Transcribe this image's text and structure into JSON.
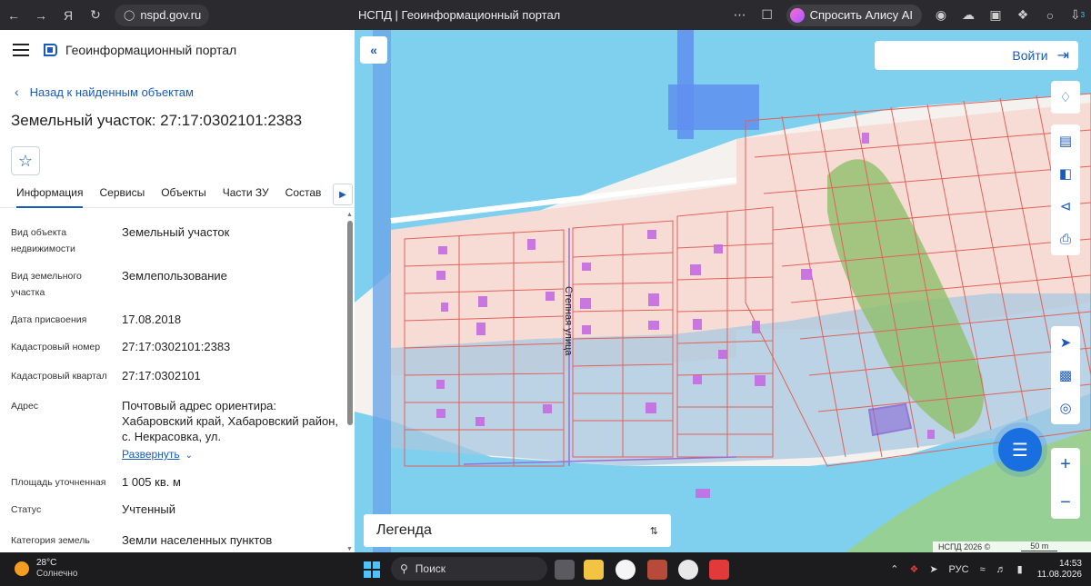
{
  "browser": {
    "url": "nspd.gov.ru",
    "tab_title": "НСПД | Геоинформационный портал",
    "alice_label": "Спросить Алису AI",
    "download_badge": "3"
  },
  "panel": {
    "portal_name": "Геоинформационный портал",
    "back_label": "Назад к найденным объектам",
    "title": "Земельный участок: 27:17:0302101:2383",
    "tabs": [
      "Информация",
      "Сервисы",
      "Объекты",
      "Части ЗУ",
      "Состав"
    ],
    "properties": [
      {
        "key": "Вид объекта недвижимости",
        "value": "Земельный участок"
      },
      {
        "key": "Вид земельного участка",
        "value": "Землепользование"
      },
      {
        "key": "Дата присвоения",
        "value": "17.08.2018"
      },
      {
        "key": "Кадастровый номер",
        "value": "27:17:0302101:2383"
      },
      {
        "key": "Кадастровый квартал",
        "value": "27:17:0302101"
      },
      {
        "key": "Адрес",
        "value": "Почтовый адрес ориентира: Хабаровский край, Хабаровский район, с. Некрасовка, ул."
      },
      {
        "key": "Площадь уточненная",
        "value": "1 005 кв. м"
      },
      {
        "key": "Статус",
        "value": "Учтенный"
      },
      {
        "key": "Категория земель",
        "value": "Земли населенных пунктов"
      }
    ],
    "expand_label": "Развернуть"
  },
  "map": {
    "login_label": "Войти",
    "legend_label": "Легенда",
    "street_label": "Степная улица",
    "copyright": "НСПД 2026 ©",
    "scale_label": "50 m",
    "colors": {
      "water": "#7fd0ef",
      "parcel_fill": "#f7dcd6",
      "parcel_line": "#e0625a",
      "building": "#c56be3",
      "green": "#8fbf6a",
      "selected": "#7a3ccf"
    }
  },
  "taskbar": {
    "temperature": "28°C",
    "weather": "Солнечно",
    "search_placeholder": "Поиск",
    "lang": "РУС",
    "time": "14:53",
    "date": "11.08.2026"
  }
}
